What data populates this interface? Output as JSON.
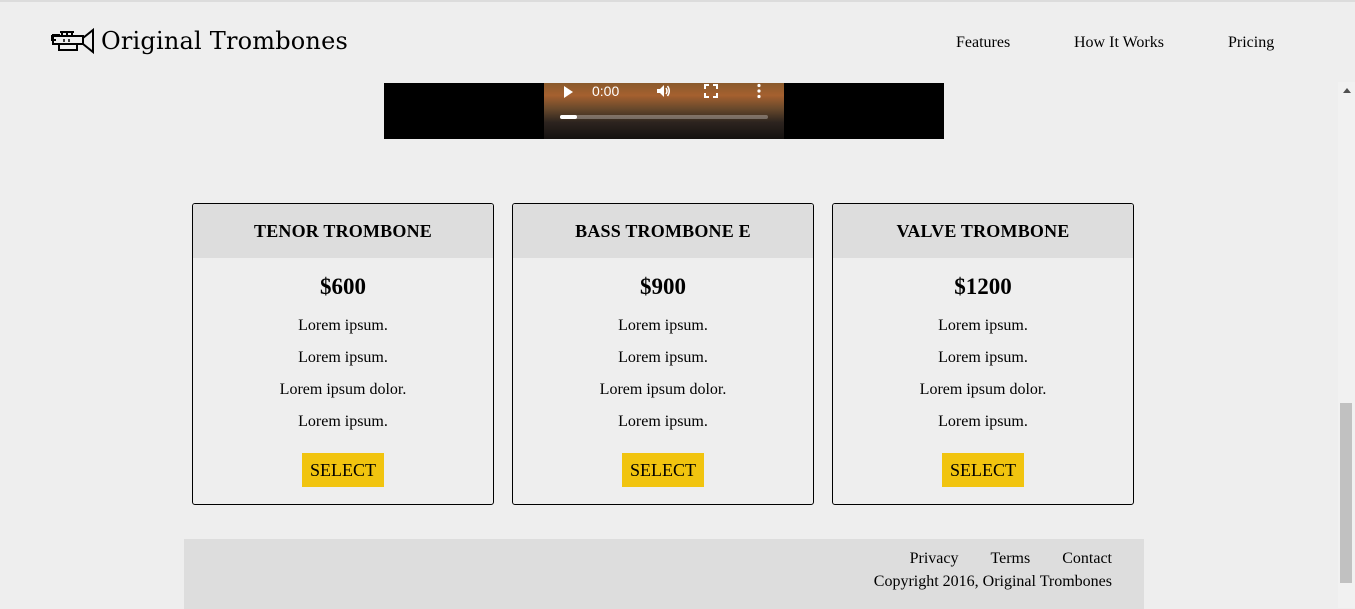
{
  "brand": {
    "name": "Original Trombones",
    "logo_icon": "trumpet-logo-icon"
  },
  "nav": {
    "items": [
      {
        "label": "Features"
      },
      {
        "label": "How It Works"
      },
      {
        "label": "Pricing"
      }
    ]
  },
  "video": {
    "time": "0:00",
    "progress": 0.08,
    "controls": [
      "play-icon",
      "volume-icon",
      "fullscreen-icon",
      "more-options-icon"
    ]
  },
  "pricing": {
    "cards": [
      {
        "title": "TENOR TROMBONE",
        "price": "$600",
        "features": [
          "Lorem ipsum.",
          "Lorem ipsum.",
          "Lorem ipsum dolor.",
          "Lorem ipsum."
        ],
        "button": "SELECT"
      },
      {
        "title": "BASS TROMBONE E",
        "price": "$900",
        "features": [
          "Lorem ipsum.",
          "Lorem ipsum.",
          "Lorem ipsum dolor.",
          "Lorem ipsum."
        ],
        "button": "SELECT"
      },
      {
        "title": "VALVE TROMBONE",
        "price": "$1200",
        "features": [
          "Lorem ipsum.",
          "Lorem ipsum.",
          "Lorem ipsum dolor.",
          "Lorem ipsum."
        ],
        "button": "SELECT"
      }
    ]
  },
  "footer": {
    "links": [
      {
        "label": "Privacy"
      },
      {
        "label": "Terms"
      },
      {
        "label": "Contact"
      }
    ],
    "copyright": "Copyright 2016, Original Trombones"
  },
  "colors": {
    "accent": "#f1c40f",
    "background": "#eeeeee",
    "card_header": "#dddddd"
  }
}
